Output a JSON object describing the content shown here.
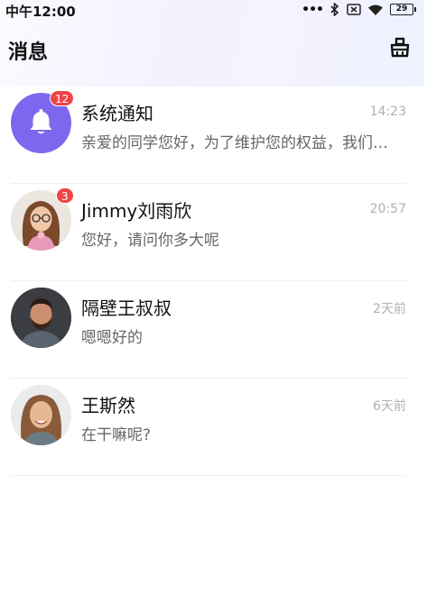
{
  "status_bar": {
    "time": "中午12:00",
    "battery": "29"
  },
  "header": {
    "title": "消息",
    "clean_icon": "broom-icon"
  },
  "messages": [
    {
      "name": "系统通知",
      "time": "14:23",
      "preview": "亲爱的同学您好，为了维护您的权益，我们…",
      "badge": "12",
      "avatar": "bell-icon",
      "avatar_color": "#7b68ee"
    },
    {
      "name": "Jimmy刘雨欣",
      "time": "20:57",
      "preview": "您好，请问你多大呢",
      "badge": "3",
      "avatar": "photo-woman-glasses"
    },
    {
      "name": "隔壁王叔叔",
      "time": "2天前",
      "preview": "嗯嗯好的",
      "avatar": "photo-man-beard"
    },
    {
      "name": "王斯然",
      "time": "6天前",
      "preview": "在干嘛呢?",
      "avatar": "photo-woman-smiling"
    }
  ],
  "colors": {
    "badge": "#f04545",
    "accent": "#7b68ee"
  }
}
